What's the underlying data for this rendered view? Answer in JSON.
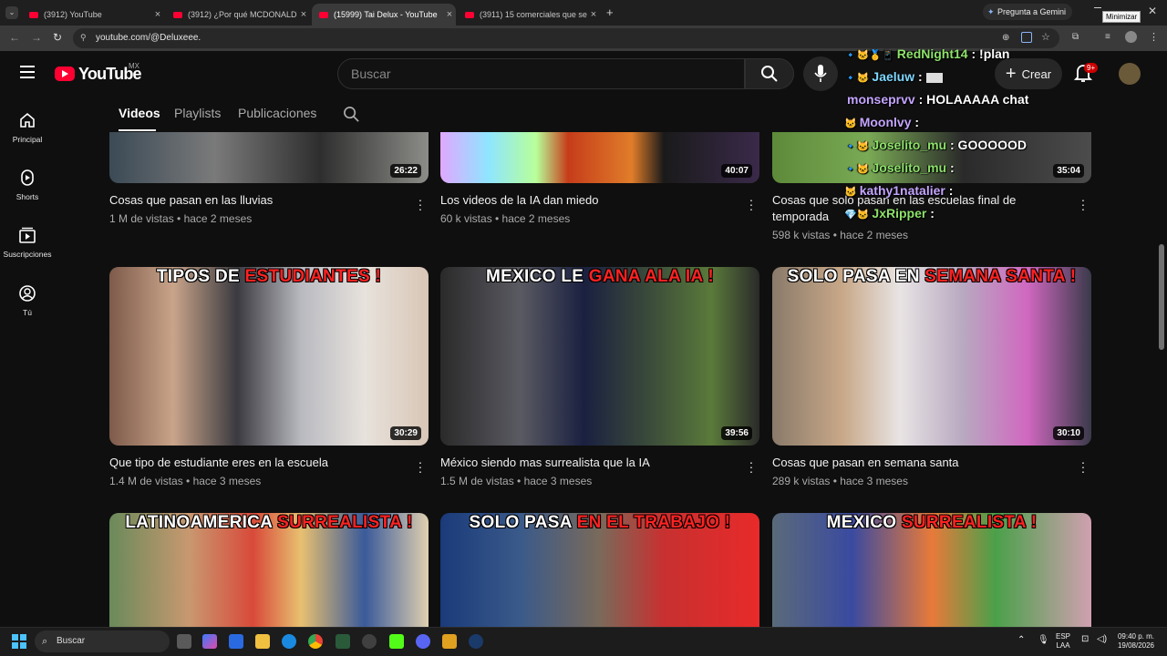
{
  "browser": {
    "tabs": [
      {
        "title": "(3912) YouTube",
        "active": false
      },
      {
        "title": "(3912) ¿Por qué MCDONALD'S",
        "active": false
      },
      {
        "title": "(15999) Tai Delux - YouTube",
        "active": true
      },
      {
        "title": "(3911) 15 comerciales que se p",
        "active": false
      }
    ],
    "new_tab_label": "+",
    "gemini_label": "Pregunta a Gemini",
    "tooltip": "Minimizar",
    "url": "youtube.com/@Deluxeee."
  },
  "header": {
    "logo_text": "YouTube",
    "country": "MX",
    "search_placeholder": "Buscar",
    "create_label": "Crear",
    "notif_count": "9+"
  },
  "sidebar": {
    "items": [
      {
        "label": "Principal",
        "icon": "home-icon"
      },
      {
        "label": "Shorts",
        "icon": "shorts-icon"
      },
      {
        "label": "Suscripciones",
        "icon": "subscriptions-icon"
      },
      {
        "label": "Tú",
        "icon": "you-icon"
      }
    ]
  },
  "channel_tabs": [
    "Videos",
    "Playlists",
    "Publicaciones"
  ],
  "videos": [
    {
      "title": "Cosas que pasan en las lluvias",
      "meta": "1 M de vistas • hace 2 meses",
      "duration": "26:22",
      "banner": ""
    },
    {
      "title": "Los videos de la IA dan miedo",
      "meta": "60 k vistas • hace 2 meses",
      "duration": "40:07",
      "banner": ""
    },
    {
      "title": "Cosas que solo pasan en las escuelas final de temporada",
      "meta": "598 k vistas • hace 2 meses",
      "duration": "35:04",
      "banner": ""
    },
    {
      "title": "Que tipo de estudiante eres en la escuela",
      "meta": "1.4 M de vistas • hace 3 meses",
      "duration": "30:29",
      "banner_white": "TIPOS DE ",
      "banner_red": "ESTUDIANTES !"
    },
    {
      "title": "México siendo mas surrealista que la IA",
      "meta": "1.5 M de vistas • hace 3 meses",
      "duration": "39:56",
      "banner_white": "MEXICO LE ",
      "banner_red": "GANA ALA IA !"
    },
    {
      "title": "Cosas que pasan en semana santa",
      "meta": "289 k vistas • hace 3 meses",
      "duration": "30:10",
      "banner_white": "SOLO PASA EN ",
      "banner_red": "SEMANA SANTA !"
    },
    {
      "banner_white": "LATINOAMERICA ",
      "banner_red": "SURREALISTA !"
    },
    {
      "banner_white": "SOLO PASA ",
      "banner_red": "EN EL TRABAJO !"
    },
    {
      "banner_white": "MEXICO ",
      "banner_red": "SURREALISTA !"
    }
  ],
  "chat": [
    {
      "user": "RedNight14",
      "msg": " : !plan",
      "badges": "🔹🐱🥇📱"
    },
    {
      "user": "Jaeluw",
      "msg": " : ",
      "badges": "🔹🐱"
    },
    {
      "user": "monseprvv",
      "msg": " : HOLAAAAA chat",
      "badges": ""
    },
    {
      "user": "Moonlvy",
      "msg": " : ",
      "badges": "🐱"
    },
    {
      "user": "Joselito_mu",
      "msg": " : GOOOOOD",
      "badges": "🔹🐱"
    },
    {
      "user": "Joselito_mu",
      "msg": " : ",
      "badges": "🔹🐱"
    },
    {
      "user": "kathy1natalier",
      "msg": " : ",
      "badges": "🐱"
    },
    {
      "user": "JxRipper",
      "msg": " : ",
      "badges": "💎🐱"
    }
  ],
  "taskbar": {
    "search_label": "Buscar",
    "lang": "ESP",
    "lang2": "LAA",
    "time": "09:40 p. m.",
    "date": "19/08/2026"
  },
  "colors": {
    "accent": "#ff0033",
    "bg": "#0f0f0f"
  }
}
